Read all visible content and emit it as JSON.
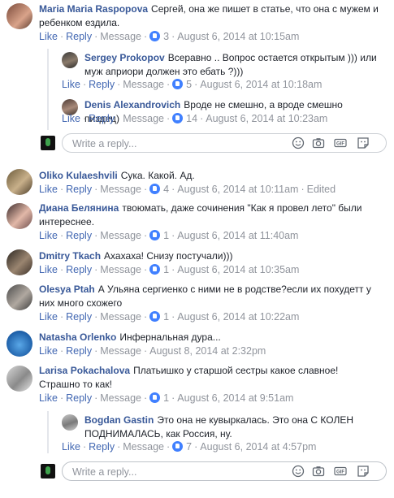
{
  "labels": {
    "like": "Like",
    "reply": "Reply",
    "message": "Message",
    "edited": "Edited",
    "sep": "·"
  },
  "reply_placeholder": "Write a reply...",
  "comments": [
    {
      "name": "Maria Maria Raspopova",
      "text": "Сергей, она же пишет в статье, что она с мужем и ребенком ездила.",
      "likes": "3",
      "time": "August 6, 2014 at 10:15am"
    },
    {
      "name": "Sergey Prokopov",
      "text": "Всеравно .. Вопрос остается открытым ))) или муж априори должен это ебать ?)))",
      "likes": "5",
      "time": "August 6, 2014 at 10:18am"
    },
    {
      "name": "Denis Alexandrovich",
      "text": "Вроде не смешно, а вроде смешно пиздец)",
      "likes": "14",
      "time": "August 6, 2014 at 10:23am"
    },
    {
      "name": "Oliko Kulaeshvili",
      "text": "Сука. Какой. Ад.",
      "likes": "4",
      "time": "August 6, 2014 at 10:11am"
    },
    {
      "name": "Диана Белянина",
      "text": "твоюмать, даже сочинения \"Как я провел лето\" были интереснее.",
      "likes": "1",
      "time": "August 6, 2014 at 11:40am"
    },
    {
      "name": "Dmitry Tkach",
      "text": "Ахахаха! Снизу постучали)))",
      "likes": "1",
      "time": "August 6, 2014 at 10:35am"
    },
    {
      "name": "Olesya Ptah",
      "text": "А Ульяна сергиенко с ними не в родстве?если их похудетт у них много схожего",
      "likes": "1",
      "time": "August 6, 2014 at 10:22am"
    },
    {
      "name": "Natasha Orlenko",
      "text": "Инфернальная дура...",
      "time": "August 8, 2014 at 2:32pm"
    },
    {
      "name": "Larisa Pokachalova",
      "text": "Платьишко у старшой сестры какое славное! Страшно то как!",
      "likes": "1",
      "time": "August 6, 2014 at 9:51am"
    },
    {
      "name": "Bogdan Gastin",
      "text": "Это она не кувыркалась. Это она С КОЛЕН ПОДНИМАЛАСЬ, как Россия, ну.",
      "likes": "7",
      "time": "August 6, 2014 at 4:57pm"
    }
  ],
  "colors": {
    "name": "#385898",
    "link": "#4267b2",
    "meta": "#90949c",
    "like_badge": "#4080ff"
  }
}
